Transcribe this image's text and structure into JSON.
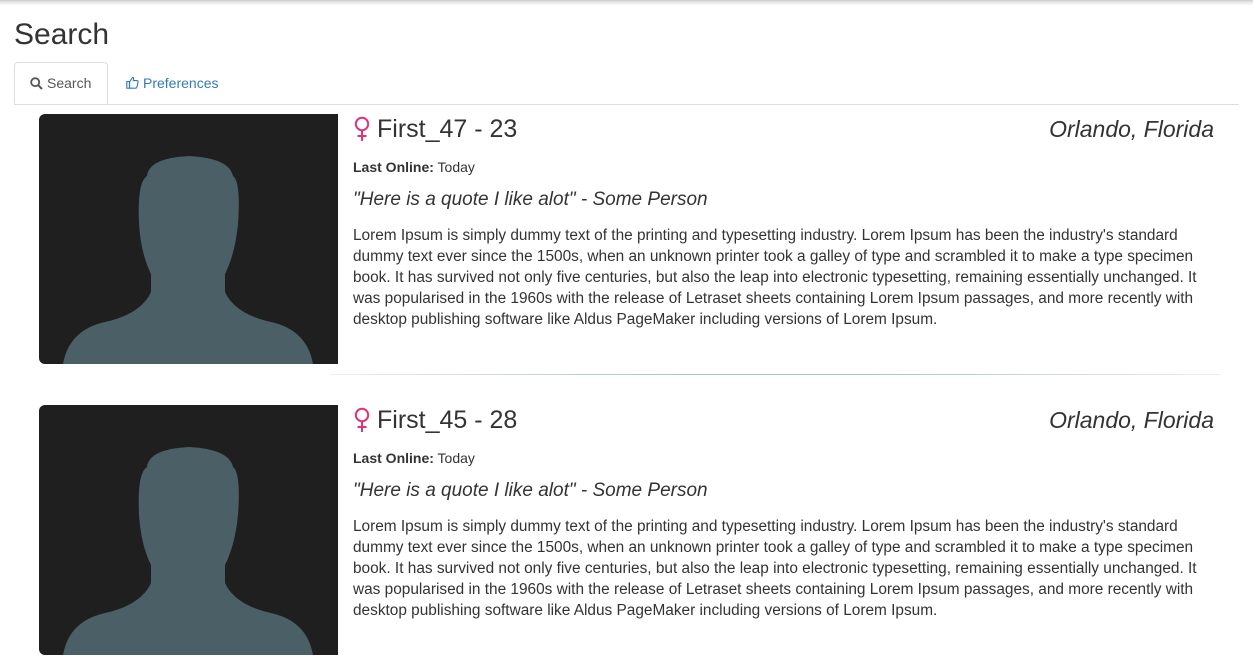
{
  "page": {
    "title": "Search"
  },
  "tabs": [
    {
      "label": "Search",
      "icon": "search-icon",
      "active": true
    },
    {
      "label": "Preferences",
      "icon": "thumbs-up-icon",
      "active": false
    }
  ],
  "results": [
    {
      "name_age": "First_47 - 23",
      "gender_icon": "female-symbol-icon",
      "location": "Orlando, Florida",
      "last_online_label": "Last Online:",
      "last_online_value": "Today",
      "quote": "\"Here is a quote I like alot\" - Some Person",
      "bio": "Lorem Ipsum is simply dummy text of the printing and typesetting industry. Lorem Ipsum has been the industry's standard dummy text ever since the 1500s, when an unknown printer took a galley of type and scrambled it to make a type specimen book. It has survived not only five centuries, but also the leap into electronic typesetting, remaining essentially unchanged. It was popularised in the 1960s with the release of Letraset sheets containing Lorem Ipsum passages, and more recently with desktop publishing software like Aldus PageMaker including versions of Lorem Ipsum."
    },
    {
      "name_age": "First_45 - 28",
      "gender_icon": "female-symbol-icon",
      "location": "Orlando, Florida",
      "last_online_label": "Last Online:",
      "last_online_value": "Today",
      "quote": "\"Here is a quote I like alot\" - Some Person",
      "bio": "Lorem Ipsum is simply dummy text of the printing and typesetting industry. Lorem Ipsum has been the industry's standard dummy text ever since the 1500s, when an unknown printer took a galley of type and scrambled it to make a type specimen book. It has survived not only five centuries, but also the leap into electronic typesetting, remaining essentially unchanged. It was popularised in the 1960s with the release of Letraset sheets containing Lorem Ipsum passages, and more recently with desktop publishing software like Aldus PageMaker including versions of Lorem Ipsum."
    }
  ],
  "colors": {
    "accent_link": "#337ab7",
    "female_icon": "#e0337f",
    "photo_bg": "#1f1f1f",
    "silhouette": "#4a6066"
  }
}
